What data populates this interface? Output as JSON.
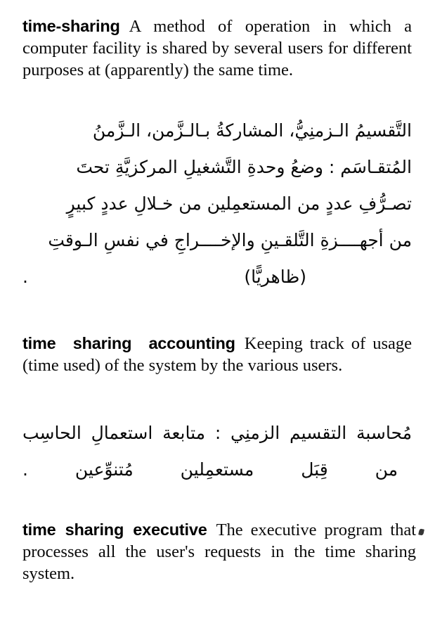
{
  "page": {
    "background_color": "#ffffff",
    "text_color": "#0a0a0a",
    "kind": "scanned-dictionary-page"
  },
  "entries": [
    {
      "headword": "time-sharing",
      "definition": "A method of operation in which a computer facility is shared by several users for different purposes at (apparently) the same time.",
      "arabic_lines": [
        "التَّقسيمُ الـزمنِيُّ، المشاركةُ بـالـزَّمن، الـزَّمنُ",
        "المُتقـاسَم : وضعُ وحدةِ التَّشغيلِ المركزيَّةِ تحتَ",
        "تصـرُّفِ عددٍ من المستعمِلين من خـلالِ عددٍ كبيرٍ",
        "من أجهــــزةِ التَّلقـينِ والإخــــراجِ في نفسِ الـوقتِ",
        "(ظاهريًّا) ."
      ]
    },
    {
      "headword": "time sharing accounting",
      "definition": "Keeping track of usage (time used) of the system by the various users.",
      "arabic_lines": [
        "مُحاسبة التقسيم الزمنِي : متابعة استعمالِ الحاسِب",
        "من قِبَل مستعمِلين مُتنوِّعين ."
      ]
    },
    {
      "headword": "time sharing executive",
      "definition": "The executive program that processes all the user's requests in the time sharing system.",
      "arabic_lines": []
    }
  ],
  "entry1_def_lines": [
    "A method of operation in",
    "which a computer facility is shared by",
    "several users for different purposes at",
    "(apparently) the same time."
  ],
  "entry2_def_lines": [
    "Keeping",
    "track of usage (time used) of the system by",
    "the various users."
  ],
  "entry3_def_lines": [
    "The executive",
    "program that processes all the user's re-",
    "quests in the time sharing system."
  ],
  "artifacts": {
    "right_edge_mark": "scan-speck"
  }
}
